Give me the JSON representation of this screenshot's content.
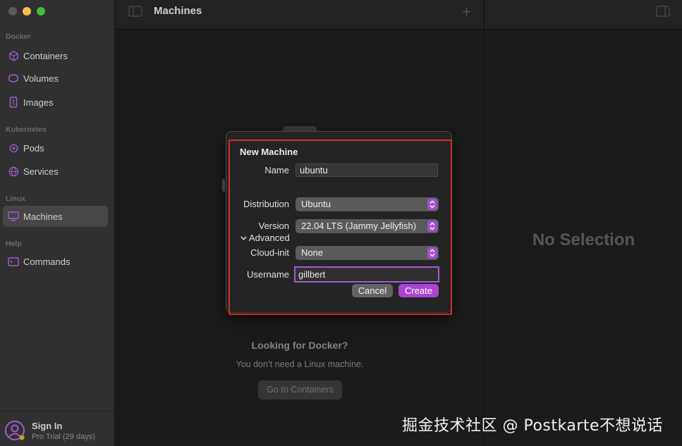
{
  "window": {
    "traffic_lights": [
      "close",
      "minimize",
      "maximize"
    ]
  },
  "sidebar": {
    "sections": [
      {
        "label": "Docker",
        "items": [
          {
            "label": "Containers",
            "icon": "cube-icon"
          },
          {
            "label": "Volumes",
            "icon": "volume-icon"
          },
          {
            "label": "Images",
            "icon": "image-icon"
          }
        ]
      },
      {
        "label": "Kubernetes",
        "items": [
          {
            "label": "Pods",
            "icon": "pod-icon"
          },
          {
            "label": "Services",
            "icon": "globe-icon"
          }
        ]
      },
      {
        "label": "Linux",
        "items": [
          {
            "label": "Machines",
            "icon": "monitor-icon",
            "selected": true
          }
        ]
      },
      {
        "label": "Help",
        "items": [
          {
            "label": "Commands",
            "icon": "terminal-icon"
          }
        ]
      }
    ],
    "footer": {
      "title": "Sign In",
      "subtitle": "Pro Trial (29 days)"
    }
  },
  "main": {
    "title": "Machines",
    "add_label": "+",
    "empty_state": {
      "title": "Looking for Docker?",
      "subtitle": "You don’t need a Linux machine.",
      "button": "Go to Containers"
    }
  },
  "detail": {
    "placeholder": "No Selection"
  },
  "dialog": {
    "title": "New Machine",
    "name_label": "Name",
    "name_value": "ubuntu",
    "distribution_label": "Distribution",
    "distribution_value": "Ubuntu",
    "version_label": "Version",
    "version_value": "22.04 LTS (Jammy Jellyfish)",
    "advanced_label": "Advanced",
    "cloudinit_label": "Cloud-init",
    "cloudinit_value": "None",
    "username_label": "Username",
    "username_value": "gillbert",
    "cancel_label": "Cancel",
    "create_label": "Create"
  },
  "watermark": "掘金技术社区 @ Postkarte不想说话",
  "colors": {
    "accent": "#a846d2",
    "highlight": "#d0302a",
    "sidebar_bg": "#303030",
    "content_bg": "#1e1e1e"
  }
}
